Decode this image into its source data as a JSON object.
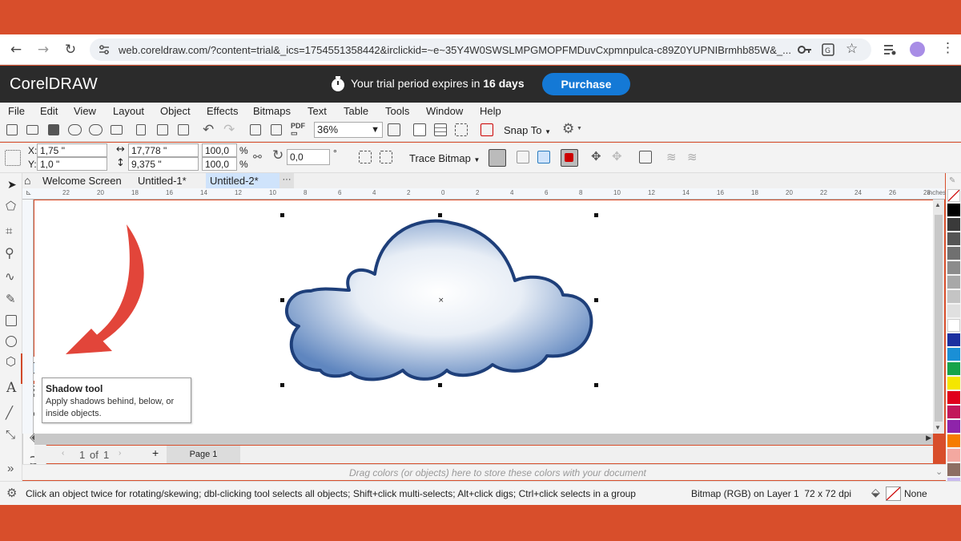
{
  "browser": {
    "url": "web.coreldraw.com/?content=trial&_ics=1754551358442&irclickid=~e~35Y4W0SWSLMPGMOPFMDuvCxpmnpulca-c89Z0YUPNIBrmhb85W&_..."
  },
  "app": {
    "logo": "CorelDRAW",
    "trial_prefix": "Your trial period expires in ",
    "trial_days": "16 days",
    "purchase_label": "Purchase"
  },
  "menu": [
    "File",
    "Edit",
    "View",
    "Layout",
    "Object",
    "Effects",
    "Bitmaps",
    "Text",
    "Table",
    "Tools",
    "Window",
    "Help"
  ],
  "toolbar": {
    "zoom": "36%",
    "snap_to": "Snap To"
  },
  "propbar": {
    "x_label": "X:",
    "x_value": "1,75 \"",
    "y_label": "Y:",
    "y_value": "1,0 \"",
    "w_value": "17,778 \"",
    "h_value": "9,375 \"",
    "sx_value": "100,0",
    "sy_value": "100,0",
    "pct": "%",
    "angle_value": "0,0",
    "deg": "°",
    "trace_bitmap": "Trace Bitmap"
  },
  "tabs": [
    "Welcome Screen",
    "Untitled-1*",
    "Untitled-2*"
  ],
  "tabs_more": "···",
  "ruler": {
    "ticks": [
      "22",
      "20",
      "18",
      "16",
      "14",
      "12",
      "10",
      "8",
      "6",
      "4",
      "2",
      "0",
      "2",
      "4",
      "6",
      "8",
      "10",
      "12",
      "14",
      "16",
      "18",
      "20",
      "22",
      "24",
      "26",
      "28"
    ],
    "unit": "inches"
  },
  "tooltip": {
    "title": "Shadow tool",
    "line1": "Apply shadows behind, below, or",
    "line2": "inside objects."
  },
  "pager": {
    "current": "1",
    "of": "of",
    "total": "1",
    "page_tab": "Page 1"
  },
  "drag_hint": "Drag colors (or objects) here to store these colors with your document",
  "status": {
    "hint": "Click an object twice for rotating/skewing; dbl-clicking tool selects all objects; Shift+click multi-selects; Alt+click digs; Ctrl+click selects in a group",
    "object_info": "Bitmap (RGB) on Layer 1  72 x 72 dpi",
    "fill": "None"
  },
  "colors": {
    "accent": "#d84e2b",
    "purchase": "#1479d6",
    "appbar": "#2b2b2b",
    "tab_active": "#cfe3fb"
  },
  "palette": [
    "#000000",
    "#3a3a3a",
    "#555555",
    "#707070",
    "#8c8c8c",
    "#a8a8a8",
    "#c4c4c4",
    "#e0e0e0",
    "#ffffff",
    "#1b2fa0",
    "#1a8fd6",
    "#16a34a",
    "#f5e600",
    "#e0001b",
    "#c2185b",
    "#8e24aa",
    "#f57c00",
    "#f3a8a0",
    "#8d6e63",
    "#c7b8f0"
  ]
}
